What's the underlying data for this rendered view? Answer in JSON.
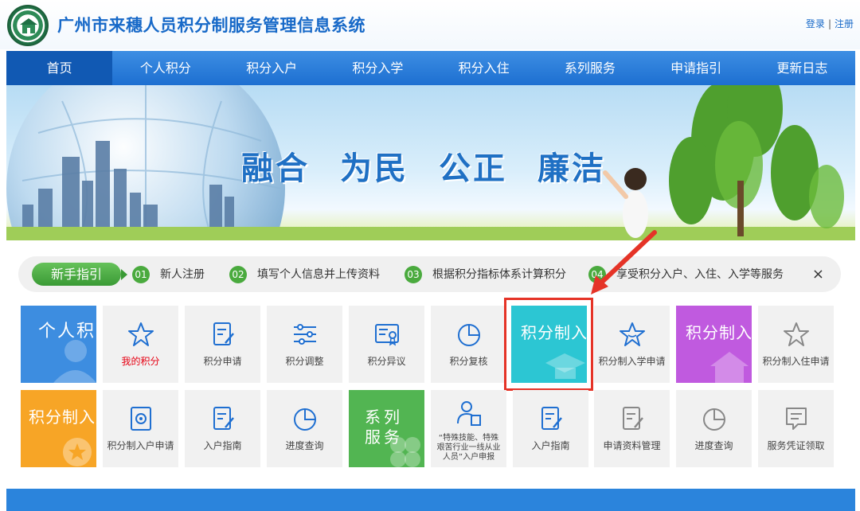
{
  "header": {
    "title": "广州市来穗人员积分制服务管理信息系统",
    "login": "登录",
    "separator": "|",
    "register": "注册"
  },
  "nav": [
    "首页",
    "个人积分",
    "积分入户",
    "积分入学",
    "积分入住",
    "系列服务",
    "申请指引",
    "更新日志"
  ],
  "banner": {
    "slogan": [
      "融合",
      "为民",
      "公正",
      "廉洁"
    ]
  },
  "guide": {
    "tag": "新手指引",
    "steps": [
      {
        "num": "01",
        "text": "新人注册"
      },
      {
        "num": "02",
        "text": "填写个人信息并上传资料"
      },
      {
        "num": "03",
        "text": "根据积分指标体系计算积分"
      },
      {
        "num": "04",
        "text": "享受积分入户、入住、入学等服务"
      }
    ],
    "close": "×"
  },
  "row1": {
    "category": "个人积分",
    "items": [
      "我的积分",
      "积分申请",
      "积分调整",
      "积分异议",
      "积分复核"
    ],
    "school_title": "积分制入学",
    "school_apply": "积分制入学申请",
    "housing_title": "积分制入住",
    "housing_apply": "积分制入住申请"
  },
  "row2": {
    "household_title": "积分制入户",
    "items": [
      "积分制入户申请",
      "入户指南",
      "进度查询"
    ],
    "series_title": "系列服务",
    "special": "“特殊技能、特殊艰苦行业一线从业人员”入户申报",
    "items2": [
      "入户指南",
      "申请资料管理",
      "进度查询",
      "服务凭证领取"
    ]
  },
  "colors": {
    "brand": "#1769c8",
    "nav": "#2a7fdb",
    "nav_active": "#1159b3",
    "guide_green": "#4aaa3e",
    "tile_blue": "#3d8de0",
    "tile_cyan": "#2cc6d3",
    "tile_purple": "#c05adf",
    "tile_orange": "#f7a526",
    "tile_green": "#52b552",
    "highlight": "#e53327"
  }
}
